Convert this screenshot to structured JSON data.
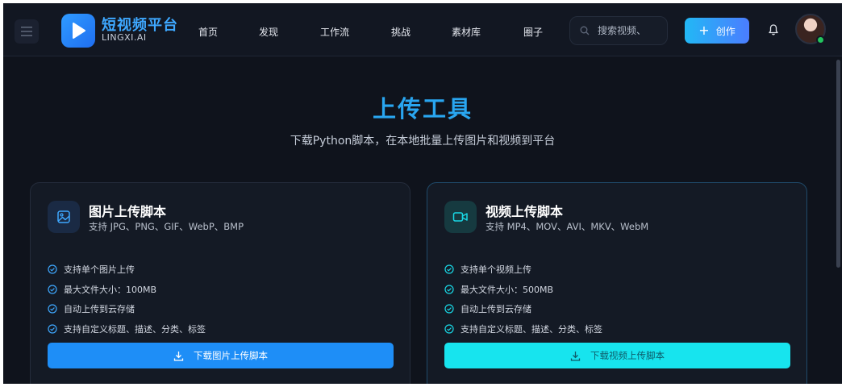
{
  "header": {
    "brand_name": "短视频平台",
    "brand_sub": "LINGXI.AI",
    "nav": [
      "首页",
      "发现",
      "工作流",
      "挑战",
      "素材库",
      "圈子"
    ],
    "search_placeholder": "搜索视频、",
    "create_label": "创作"
  },
  "hero": {
    "title": "上传工具",
    "subtitle": "下载Python脚本，在本地批量上传图片和视频到平台"
  },
  "cards": [
    {
      "title": "图片上传脚本",
      "desc": "支持 JPG、PNG、GIF、WebP、BMP",
      "features": [
        "支持单个图片上传",
        "最大文件大小：100MB",
        "自动上传到云存储",
        "支持自定义标题、描述、分类、标签"
      ],
      "button": "下载图片上传脚本",
      "icon": "image-icon"
    },
    {
      "title": "视频上传脚本",
      "desc": "支持 MP4、MOV、AVI、MKV、WebM",
      "features": [
        "支持单个视频上传",
        "最大文件大小：500MB",
        "自动上传到云存储",
        "支持自定义标题、描述、分类、标签"
      ],
      "button": "下载视频上传脚本",
      "icon": "video-icon"
    }
  ],
  "colors": {
    "accent": "#29a6f0",
    "image_button": "#1e8ef7",
    "video_button": "#17e4ee",
    "online": "#22c55e"
  }
}
